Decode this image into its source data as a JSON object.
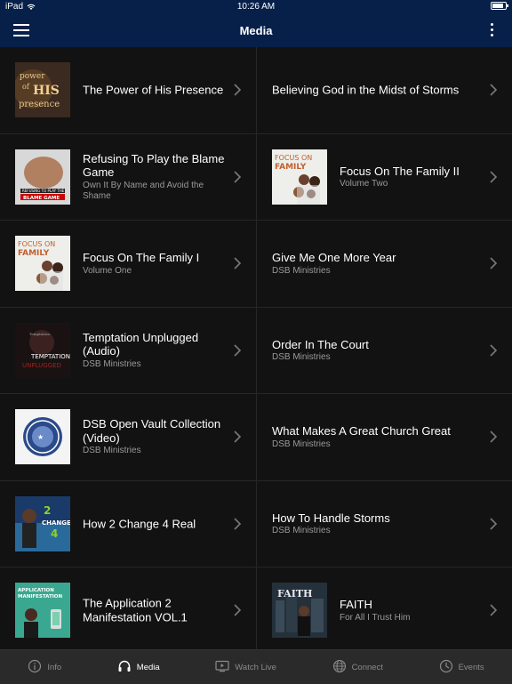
{
  "status": {
    "device": "iPad",
    "time": "10:26 AM"
  },
  "nav": {
    "title": "Media"
  },
  "left_items": [
    {
      "title": "The Power of His Presence",
      "subtitle": "",
      "thumb_text": "power of HIS presence",
      "icon": "power-presence-cover"
    },
    {
      "title": "Refusing To Play the Blame Game",
      "subtitle": "Own It By Name and Avoid the Shame",
      "thumb_text": "REFUSING TO PLAY THE BLAME GAME",
      "icon": "blame-game-cover"
    },
    {
      "title": "Focus On The Family I",
      "subtitle": "Volume One",
      "thumb_text": "FOCUS ON THE FAMILY",
      "icon": "focus-family-cover"
    },
    {
      "title": "Temptation Unplugged (Audio)",
      "subtitle": "DSB Ministries",
      "thumb_text": "TEMPTATION",
      "icon": "temptation-cover"
    },
    {
      "title": "DSB Open Vault Collection (Video)",
      "subtitle": "DSB Ministries",
      "thumb_text": "",
      "icon": "dsb-seal-cover"
    },
    {
      "title": "How 2 Change 4 Real",
      "subtitle": "",
      "thumb_text": "2 CHANGE 4",
      "icon": "change-real-cover"
    },
    {
      "title": "The Application 2 Manifestation VOL.1",
      "subtitle": "",
      "thumb_text": "APPLICATION MANIFESTATION",
      "icon": "application-cover"
    }
  ],
  "right_items": [
    {
      "title": "Believing God in the Midst of Storms",
      "subtitle": "",
      "thumb_text": "",
      "icon": ""
    },
    {
      "title": "Focus On The Family II",
      "subtitle": "Volume Two",
      "thumb_text": "FOCUS ON THE FAMILY",
      "icon": "focus-family-cover"
    },
    {
      "title": "Give Me One More Year",
      "subtitle": "DSB Ministries",
      "thumb_text": "",
      "icon": ""
    },
    {
      "title": "Order In The Court",
      "subtitle": "DSB Ministries",
      "thumb_text": "",
      "icon": ""
    },
    {
      "title": "What Makes A Great Church Great",
      "subtitle": "DSB Ministries",
      "thumb_text": "",
      "icon": ""
    },
    {
      "title": "How To Handle Storms",
      "subtitle": "DSB Ministries",
      "thumb_text": "",
      "icon": ""
    },
    {
      "title": "FAITH",
      "subtitle": "For All I Trust Him",
      "thumb_text": "FAITH",
      "icon": "faith-cover"
    }
  ],
  "tabs": [
    {
      "label": "Info",
      "icon": "info-icon",
      "active": false
    },
    {
      "label": "Media",
      "icon": "headphones-icon",
      "active": true
    },
    {
      "label": "Watch Live",
      "icon": "tv-icon",
      "active": false
    },
    {
      "label": "Connect",
      "icon": "globe-icon",
      "active": false
    },
    {
      "label": "Events",
      "icon": "clock-icon",
      "active": false
    }
  ]
}
